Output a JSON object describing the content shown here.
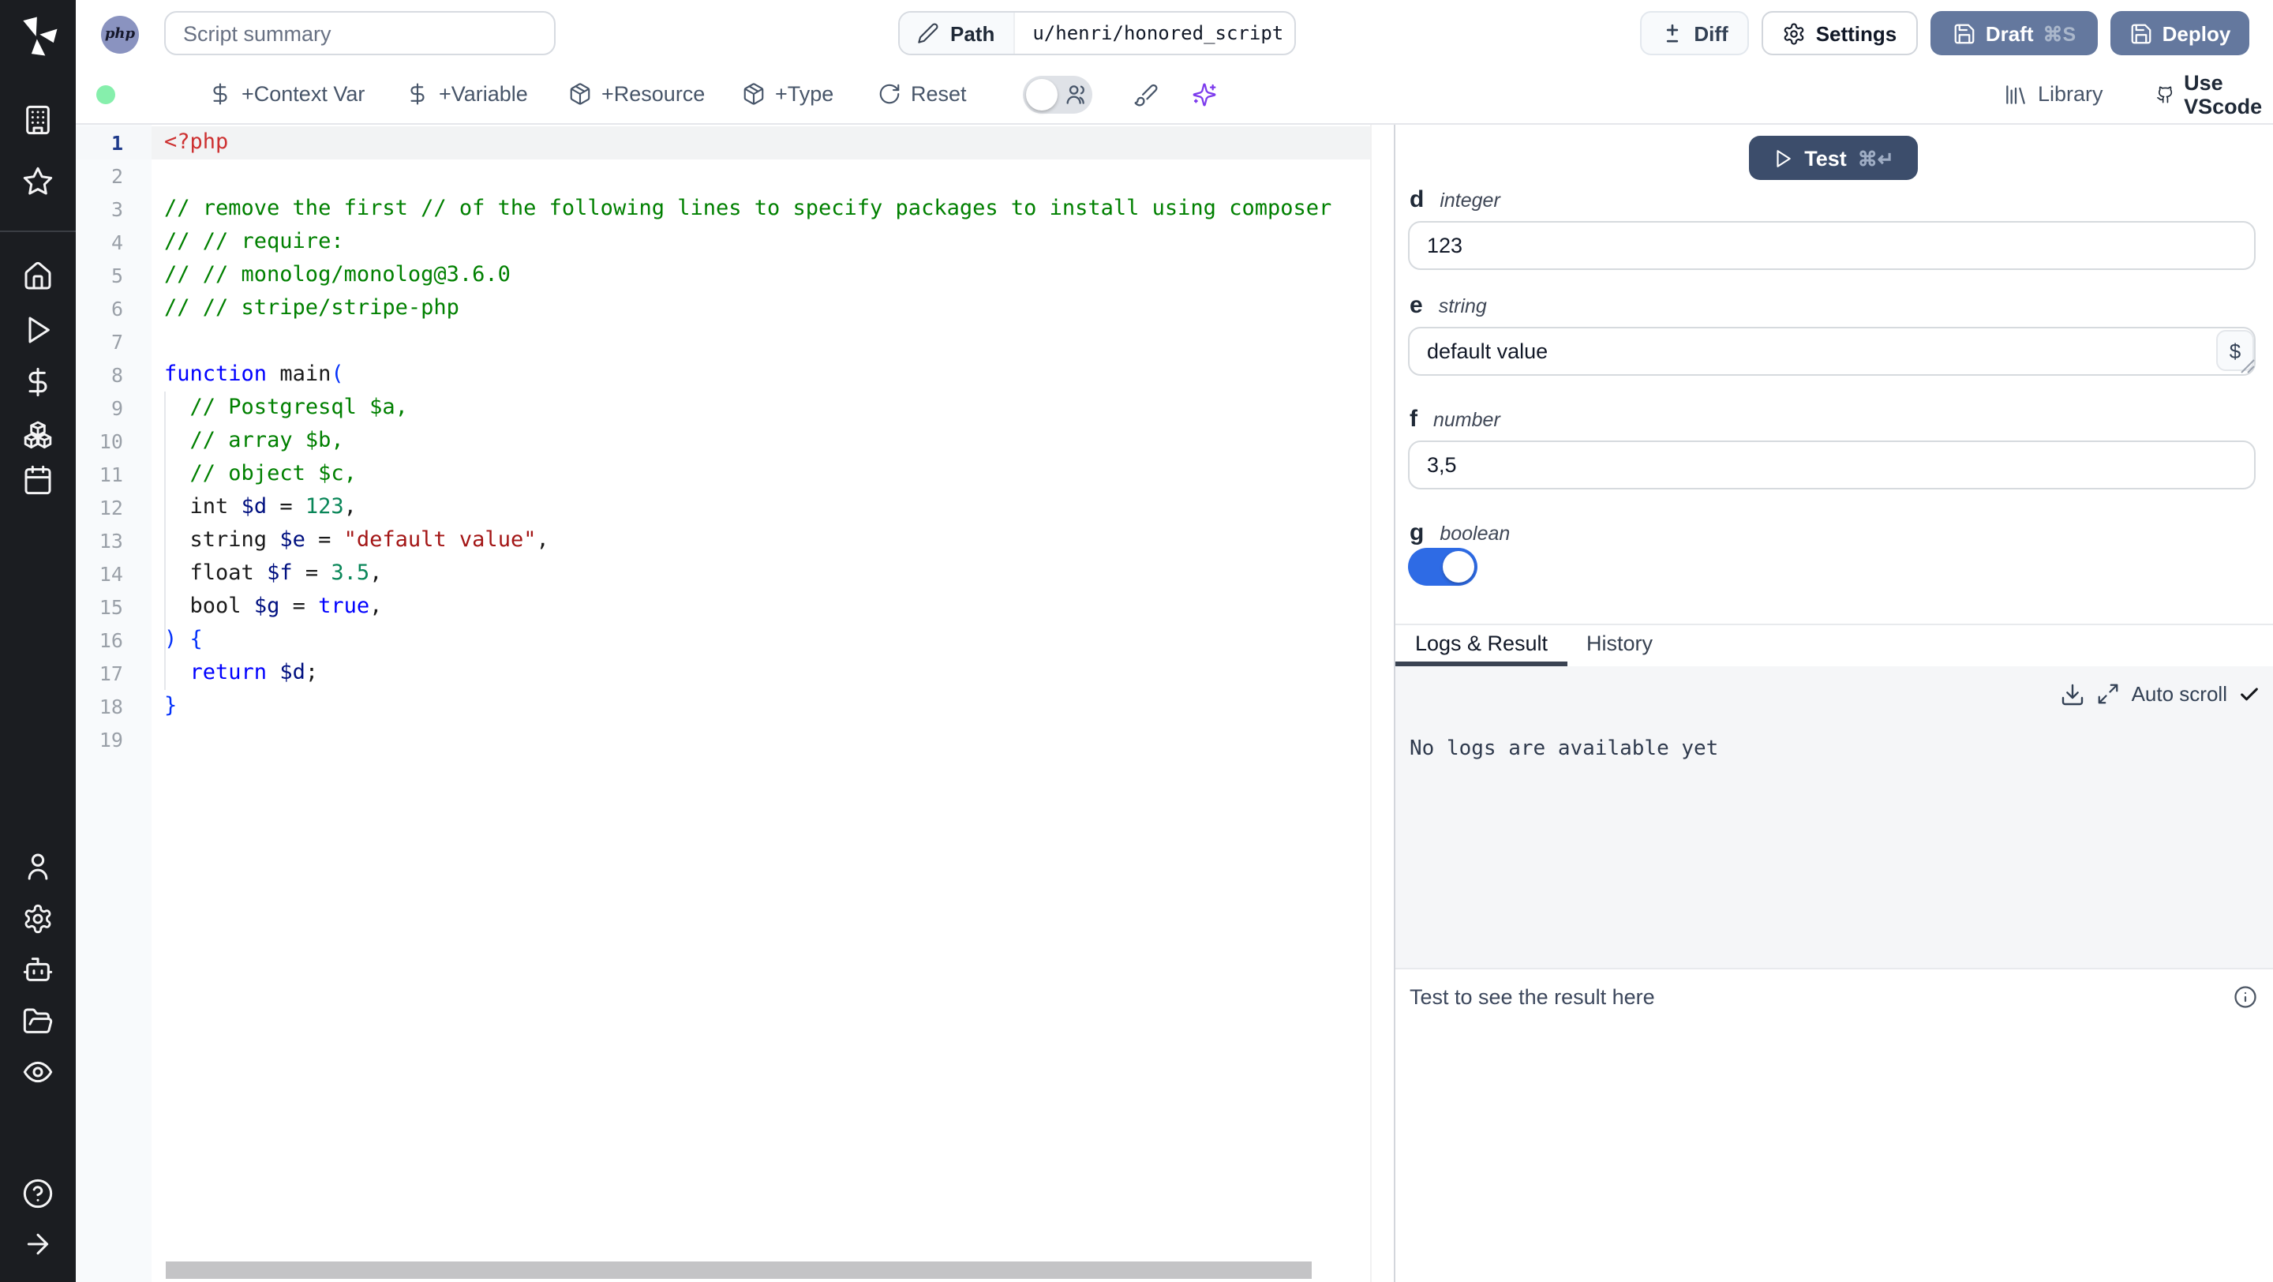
{
  "colors": {
    "sidebar_bg": "#1b1d21",
    "primary_button": "#64789e",
    "test_button": "#3c4d6b",
    "toggle_on": "#2e6be5",
    "status_dot": "#86efac",
    "sparkles_accent": "#7c3aed",
    "active_tab_underline": "#3a4352"
  },
  "sidebar": {
    "icons_top": [
      "building",
      "star"
    ],
    "icons_main": [
      "home",
      "play",
      "dollar-sign",
      "boxes",
      "calendar"
    ],
    "icons_bottom": [
      "user",
      "settings-gear",
      "bot",
      "folder-open",
      "eye"
    ],
    "icons_footer": [
      "help-circle",
      "arrow-right"
    ]
  },
  "topbar": {
    "language_badge": "php",
    "summary_placeholder": "Script summary",
    "path_label": "Path",
    "path_value": "u/henri/honored_script",
    "diff_label": "Diff",
    "settings_label": "Settings",
    "draft_label": "Draft",
    "draft_shortcut": "⌘S",
    "deploy_label": "Deploy"
  },
  "toolbar": {
    "status_dot": "green",
    "add_context_var": "+Context Var",
    "add_variable": "+Variable",
    "add_resource": "+Resource",
    "add_type": "+Type",
    "reset_label": "Reset",
    "assistant_toggle_on": false,
    "library_label": "Library",
    "vscode_label": "Use VScode"
  },
  "editor": {
    "language": "php",
    "active_line": 1,
    "lines": [
      [
        [
          "tag",
          "<?php"
        ]
      ],
      [],
      [
        [
          "com",
          "// remove the first // of the following lines to specify packages to install using composer"
        ]
      ],
      [
        [
          "com",
          "// // require:"
        ]
      ],
      [
        [
          "com",
          "// // monolog/monolog@3.6.0"
        ]
      ],
      [
        [
          "com",
          "// // stripe/stripe-php"
        ]
      ],
      [],
      [
        [
          "kw",
          "function"
        ],
        [
          "pl",
          " main"
        ],
        [
          "br",
          "("
        ]
      ],
      [
        [
          "pl",
          "  "
        ],
        [
          "com",
          "// Postgresql $a,"
        ]
      ],
      [
        [
          "pl",
          "  "
        ],
        [
          "com",
          "// array $b,"
        ]
      ],
      [
        [
          "pl",
          "  "
        ],
        [
          "com",
          "// object $c,"
        ]
      ],
      [
        [
          "pl",
          "  int "
        ],
        [
          "var",
          "$d"
        ],
        [
          "pl",
          " = "
        ],
        [
          "num",
          "123"
        ],
        [
          "pl",
          ","
        ]
      ],
      [
        [
          "pl",
          "  string "
        ],
        [
          "var",
          "$e"
        ],
        [
          "pl",
          " = "
        ],
        [
          "str",
          "\"default value\""
        ],
        [
          "pl",
          ","
        ]
      ],
      [
        [
          "pl",
          "  float "
        ],
        [
          "var",
          "$f"
        ],
        [
          "pl",
          " = "
        ],
        [
          "num",
          "3.5"
        ],
        [
          "pl",
          ","
        ]
      ],
      [
        [
          "pl",
          "  bool "
        ],
        [
          "var",
          "$g"
        ],
        [
          "pl",
          " = "
        ],
        [
          "kw",
          "true"
        ],
        [
          "pl",
          ","
        ]
      ],
      [
        [
          "br",
          ") {"
        ]
      ],
      [
        [
          "pl",
          "  "
        ],
        [
          "kw",
          "return"
        ],
        [
          "pl",
          " "
        ],
        [
          "var",
          "$d"
        ],
        [
          "pl",
          ";"
        ]
      ],
      [
        [
          "br",
          "}"
        ]
      ],
      []
    ]
  },
  "runner": {
    "test_label": "Test",
    "test_shortcut": "⌘↵",
    "args": {
      "d": {
        "name": "d",
        "type": "integer",
        "value": "123"
      },
      "e": {
        "name": "e",
        "type": "string",
        "value": "default value",
        "dollar_button": "$"
      },
      "f": {
        "name": "f",
        "type": "number",
        "value": "3,5"
      },
      "g": {
        "name": "g",
        "type": "boolean",
        "value": true
      }
    },
    "tabs": {
      "logs": "Logs & Result",
      "history": "History"
    },
    "logs": {
      "autoscroll_label": "Auto scroll",
      "autoscroll_checked": true,
      "empty_message": "No logs are available yet"
    },
    "result": {
      "placeholder": "Test to see the result here"
    }
  }
}
